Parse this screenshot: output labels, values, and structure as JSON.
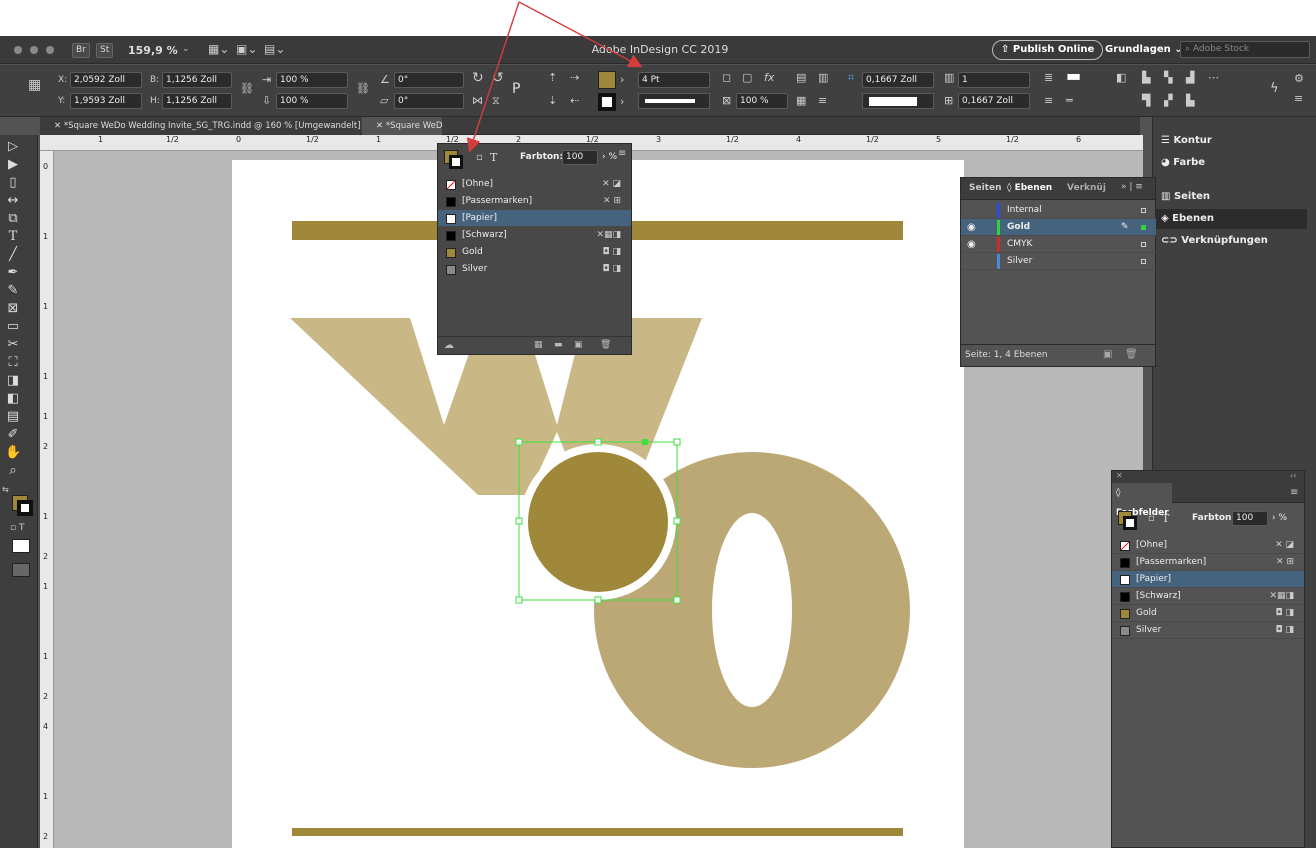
{
  "app": {
    "title": "Adobe InDesign CC 2019",
    "zoom": "159,9 %",
    "bridge": "Br",
    "stock": "St",
    "publish_label": "Publish Online",
    "workspace": "Grundlagen",
    "search_placeholder": "Adobe Stock"
  },
  "control": {
    "x_label": "X:",
    "x": "2,0592 Zoll",
    "y_label": "Y:",
    "y": "1,9593 Zoll",
    "w_label": "B:",
    "w": "1,1256 Zoll",
    "h_label": "H:",
    "h": "1,1256 Zoll",
    "scale_x": "100 %",
    "scale_y": "100 %",
    "rotate": "0°",
    "shear": "0°",
    "stroke_weight": "4 Pt",
    "opacity": "100 %",
    "offset": "0,1667 Zoll",
    "columns": "1",
    "gutter": "0,1667 Zoll",
    "p_label": "P"
  },
  "tabs": [
    {
      "label": "*Square WeDo Wedding Invite_SG_TRG.indd @ 160 % [Umgewandelt]"
    },
    {
      "label": "*Square WeDo"
    }
  ],
  "ruler": {
    "h": [
      "1",
      "1/2",
      "0",
      "1/2",
      "1",
      "1/2",
      "2",
      "1/2",
      "3",
      "1/2",
      "4",
      "1/2",
      "5",
      "1/2",
      "6"
    ],
    "v": [
      "0",
      "1",
      "1",
      "1",
      "1",
      "2",
      "1",
      "2",
      "1",
      "1",
      "2",
      "4",
      "1",
      "2"
    ]
  },
  "swatch_popup": {
    "farbton_label": "Farbton:",
    "farbton": "100",
    "pct": "%",
    "t_label": "T",
    "items": [
      {
        "name": "[Ohne]",
        "color": "#ffffff"
      },
      {
        "name": "[Passermarken]",
        "color": "#000000"
      },
      {
        "name": "[Papier]",
        "color": "#ffffff"
      },
      {
        "name": "[Schwarz]",
        "color": "#000000"
      },
      {
        "name": "Gold",
        "color": "#a0883a"
      },
      {
        "name": "Silver",
        "color": "#8a8a8a"
      }
    ]
  },
  "layers_panel": {
    "tabs": [
      "Seiten",
      "Ebenen",
      "Verknüj"
    ],
    "layers": [
      {
        "name": "Internal",
        "color": "#2a4de0"
      },
      {
        "name": "Gold",
        "color": "#36d13a"
      },
      {
        "name": "CMYK",
        "color": "#d02a2a"
      },
      {
        "name": "Silver",
        "color": "#4a88e0"
      }
    ],
    "status": "Seite: 1, 4 Ebenen"
  },
  "dock": {
    "items": [
      "Kontur",
      "Farbe",
      "Seiten",
      "Ebenen",
      "Verknüpfungen"
    ]
  },
  "swatches_panel": {
    "title": "Farbfelder",
    "t_label": "T",
    "farbton_label": "Farbton:",
    "farbton": "100",
    "pct": "%",
    "items": [
      {
        "name": "[Ohne]",
        "color": "#ffffff"
      },
      {
        "name": "[Passermarken]",
        "color": "#000000"
      },
      {
        "name": "[Papier]",
        "color": "#ffffff"
      },
      {
        "name": "[Schwarz]",
        "color": "#000000"
      },
      {
        "name": "Gold",
        "color": "#a0883a"
      },
      {
        "name": "Silver",
        "color": "#8a8a8a"
      }
    ]
  },
  "colors": {
    "gold": "#a0883a",
    "gold_light": "#c9b886",
    "gold_medium": "#bca874",
    "selection": "#45637d",
    "frame": "#3be23b",
    "arrow": "#d63c3c"
  }
}
